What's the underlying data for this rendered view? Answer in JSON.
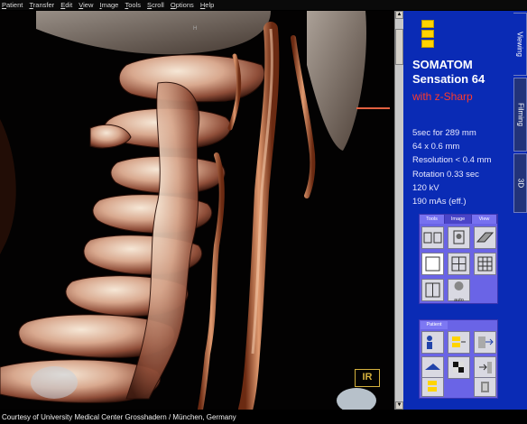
{
  "menu": [
    "Patient",
    "Transfer",
    "Edit",
    "View",
    "Image",
    "Tools",
    "Scroll",
    "Options",
    "Help"
  ],
  "viewport": {
    "orientation_marker": "H",
    "badge": "IR"
  },
  "scrollbar": {
    "up": "▲",
    "down": "▼"
  },
  "panel": {
    "line1": "SOMATOM",
    "line2": "Sensation 64",
    "line3": "with z-Sharp",
    "specs": [
      "5sec for 289 mm",
      "64 x 0.6 mm",
      "Resolution < 0.4 mm",
      "Rotation 0.33 sec",
      "120 kV",
      "190 mAs (eff.)"
    ],
    "toolbox_tabs": [
      "Tools",
      "Image",
      "View"
    ],
    "patient_tab": "Patient",
    "auto_label": "auto"
  },
  "side_tabs": [
    "Viewing",
    "Filming",
    "3D"
  ],
  "footer": "Courtesy of University Medical Center Grosshadern / München, Germany",
  "colors": {
    "panel_blue": "#0a2bb5",
    "brand_red": "#ff3a2a",
    "toolbox_purple": "#6a64e6"
  }
}
